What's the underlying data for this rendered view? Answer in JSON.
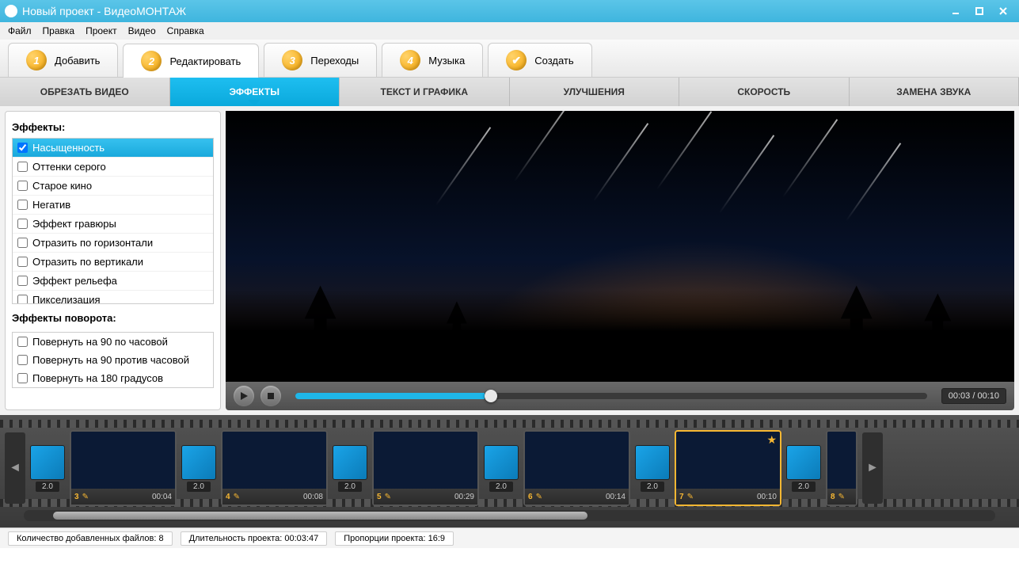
{
  "window": {
    "title": "Новый проект - ВидеоМОНТАЖ"
  },
  "menu": [
    "Файл",
    "Правка",
    "Проект",
    "Видео",
    "Справка"
  ],
  "steps": [
    {
      "num": "1",
      "label": "Добавить"
    },
    {
      "num": "2",
      "label": "Редактировать"
    },
    {
      "num": "3",
      "label": "Переходы"
    },
    {
      "num": "4",
      "label": "Музыка"
    },
    {
      "num": "✔",
      "label": "Создать"
    }
  ],
  "activeStep": 1,
  "subtabs": [
    "ОБРЕЗАТЬ ВИДЕО",
    "ЭФФЕКТЫ",
    "ТЕКСТ И ГРАФИКА",
    "УЛУЧШЕНИЯ",
    "СКОРОСТЬ",
    "ЗАМЕНА ЗВУКА"
  ],
  "activeSubtab": 1,
  "effects": {
    "heading": "Эффекты:",
    "items": [
      {
        "label": "Насыщенность",
        "checked": true,
        "selected": true
      },
      {
        "label": "Оттенки серого",
        "checked": false
      },
      {
        "label": "Старое кино",
        "checked": false
      },
      {
        "label": "Негатив",
        "checked": false
      },
      {
        "label": "Эффект гравюры",
        "checked": false
      },
      {
        "label": "Отразить по горизонтали",
        "checked": false
      },
      {
        "label": "Отразить по вертикали",
        "checked": false
      },
      {
        "label": "Эффект рельефа",
        "checked": false
      },
      {
        "label": "Пикселизация",
        "checked": false
      }
    ],
    "rotation_heading": "Эффекты поворота:",
    "rotation_items": [
      {
        "label": "Повернуть на 90 по часовой",
        "checked": false
      },
      {
        "label": "Повернуть на 90 против часовой",
        "checked": false
      },
      {
        "label": "Повернуть на 180 градусов",
        "checked": false
      }
    ]
  },
  "player": {
    "time": "00:03 / 00:10"
  },
  "timeline": {
    "transition_label": "2.0",
    "clips": [
      {
        "num": "3",
        "duration": "00:04",
        "thumb": "th3"
      },
      {
        "num": "4",
        "duration": "00:08",
        "thumb": "th4"
      },
      {
        "num": "5",
        "duration": "00:29",
        "thumb": "th5"
      },
      {
        "num": "6",
        "duration": "00:14",
        "thumb": "th6"
      },
      {
        "num": "7",
        "duration": "00:10",
        "thumb": "th7",
        "selected": true,
        "starred": true
      },
      {
        "num": "8",
        "duration": "",
        "thumb": "th8",
        "partial": true
      }
    ]
  },
  "status": {
    "files_label": "Количество добавленных файлов:",
    "files_value": "8",
    "duration_label": "Длительность проекта:",
    "duration_value": "00:03:47",
    "aspect_label": "Пропорции проекта:",
    "aspect_value": "16:9"
  }
}
